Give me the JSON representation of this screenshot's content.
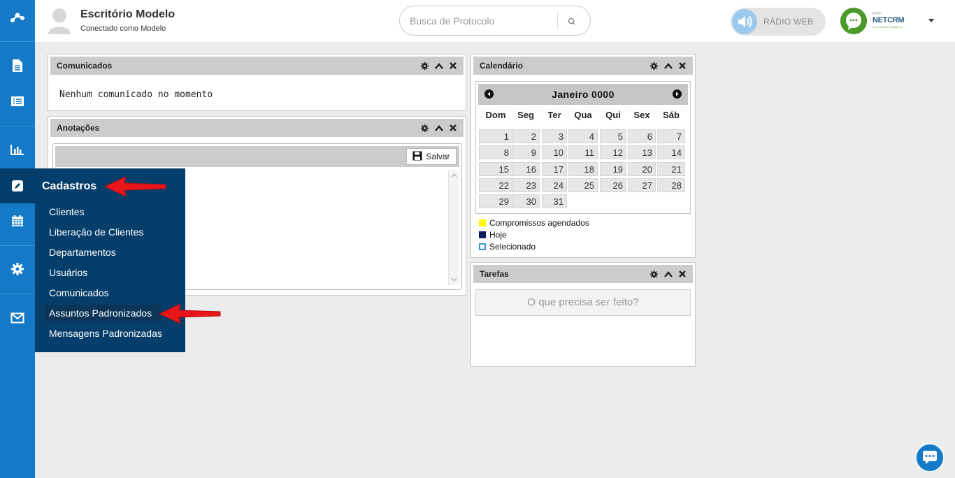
{
  "header": {
    "company_name": "Escritório Modelo",
    "connected_as": "Conectado como Modelo",
    "search_placeholder": "Busca de Protocolo",
    "radio_label": "RÁDIO WEB",
    "brand_small": "grupo",
    "brand_name": "NETCRM",
    "brand_tagline": "comunicação inteligente"
  },
  "sidebar": {
    "items": [
      "logo-icon",
      "document-icon",
      "list-icon",
      "chart-icon",
      "edit-icon",
      "calendar-icon",
      "gear-icon",
      "mail-icon"
    ],
    "active": "edit-icon"
  },
  "menu": {
    "title": "Cadastros",
    "items": [
      "Clientes",
      "Liberação de Clientes",
      "Departamentos",
      "Usuários",
      "Comunicados",
      "Assuntos Padronizados",
      "Mensagens Padronizadas"
    ],
    "highlighted": "Assuntos Padronizados"
  },
  "comunicados": {
    "title": "Comunicados",
    "message": "Nenhum comunicado no momento"
  },
  "anotacoes": {
    "title": "Anotações",
    "save_label": "Salvar"
  },
  "calendario": {
    "title": "Calendário",
    "month": "Janeiro 0000",
    "weekdays": [
      "Dom",
      "Seg",
      "Ter",
      "Qua",
      "Qui",
      "Sex",
      "Sáb"
    ],
    "days": [
      "1",
      "2",
      "3",
      "4",
      "5",
      "6",
      "7",
      "8",
      "9",
      "10",
      "11",
      "12",
      "13",
      "14",
      "15",
      "16",
      "17",
      "18",
      "19",
      "20",
      "21",
      "22",
      "23",
      "24",
      "25",
      "26",
      "27",
      "28",
      "29",
      "30",
      "31"
    ],
    "legend": [
      {
        "label": "Compromissos agendados",
        "color": "#ffff00"
      },
      {
        "label": "Hoje",
        "color": "#0a1a5e"
      },
      {
        "label": "Selecionado",
        "color": "#3a9ad9"
      }
    ]
  },
  "tarefas": {
    "title": "Tarefas",
    "placeholder": "O que precisa ser feito?"
  },
  "colors": {
    "sidebar": "#1479c7",
    "menu_bg": "#053e6a",
    "arrow": "#e8161b"
  }
}
